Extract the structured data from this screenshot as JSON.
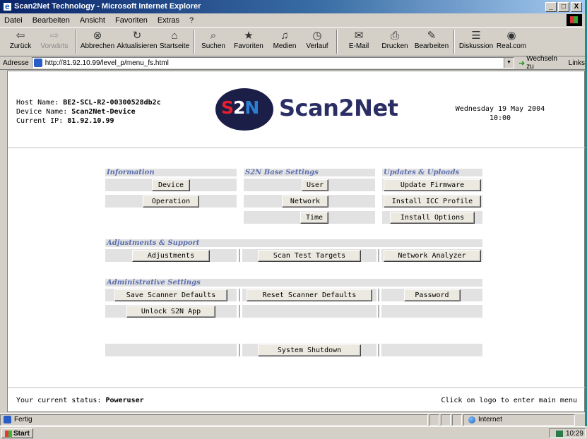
{
  "window": {
    "title": "Scan2Net Technology - Microsoft Internet Explorer",
    "controls": [
      "_",
      "□",
      "X"
    ]
  },
  "menubar": [
    "Datei",
    "Bearbeiten",
    "Ansicht",
    "Favoriten",
    "Extras",
    "?"
  ],
  "toolbar": [
    {
      "label": "Zurück",
      "icon": "⇦",
      "name": "back"
    },
    {
      "label": "Vorwärts",
      "icon": "⇨",
      "name": "forward",
      "disabled": true
    },
    {
      "label": "Abbrechen",
      "icon": "⊗",
      "name": "stop"
    },
    {
      "label": "Aktualisieren",
      "icon": "↻",
      "name": "refresh"
    },
    {
      "label": "Startseite",
      "icon": "⌂",
      "name": "home"
    },
    {
      "label": "Suchen",
      "icon": "⌕",
      "name": "search"
    },
    {
      "label": "Favoriten",
      "icon": "★",
      "name": "favorites"
    },
    {
      "label": "Medien",
      "icon": "♫",
      "name": "media"
    },
    {
      "label": "Verlauf",
      "icon": "◷",
      "name": "history"
    },
    {
      "label": "E-Mail",
      "icon": "✉",
      "name": "mail"
    },
    {
      "label": "Drucken",
      "icon": "⎙",
      "name": "print"
    },
    {
      "label": "Bearbeiten",
      "icon": "✎",
      "name": "edit"
    },
    {
      "label": "Diskussion",
      "icon": "☰",
      "name": "discuss"
    },
    {
      "label": "Real.com",
      "icon": "◉",
      "name": "realcom"
    }
  ],
  "address": {
    "label": "Adresse",
    "url": "http://81.92.10.99/level_p/menu_fs.html",
    "go_label": "Wechseln zu",
    "links_label": "Links"
  },
  "header": {
    "host_label": "Host Name:",
    "host_value": "BE2-SCL-R2-00300528db2c",
    "device_label": "Device Name:",
    "device_value": "Scan2Net-Device",
    "ip_label": "Current IP:",
    "ip_value": "81.92.10.99",
    "logo_mark": [
      "S",
      "2",
      "N"
    ],
    "logo_text": "Scan2Net",
    "logo_reg": "®",
    "date": "Wednesday 19 May 2004",
    "time": "10:00"
  },
  "sections": {
    "information": "Information",
    "base_settings": "S2N Base Settings",
    "updates": "Updates & Uploads",
    "adjustments_support": "Adjustments & Support",
    "administrative": "Administrative Settings"
  },
  "buttons": {
    "device": "Device",
    "operation": "Operation",
    "user": "User",
    "network": "Network",
    "time": "Time",
    "update_firmware": "Update Firmware",
    "install_icc": "Install ICC Profile",
    "install_options": "Install Options",
    "adjustments": "Adjustments",
    "scan_test_targets": "Scan Test Targets",
    "network_analyzer": "Network Analyzer",
    "save_defaults": "Save Scanner Defaults",
    "reset_defaults": "Reset Scanner Defaults",
    "password": "Password",
    "unlock_app": "Unlock S2N App",
    "shutdown": "System Shutdown"
  },
  "footer": {
    "status_label": "Your current status:",
    "status_value": "Poweruser",
    "hint": "Click on logo to enter main menu"
  },
  "statusbar": {
    "text": "Fertig",
    "zone": "Internet"
  },
  "taskbar": {
    "start": "Start",
    "clock": "10:29"
  }
}
